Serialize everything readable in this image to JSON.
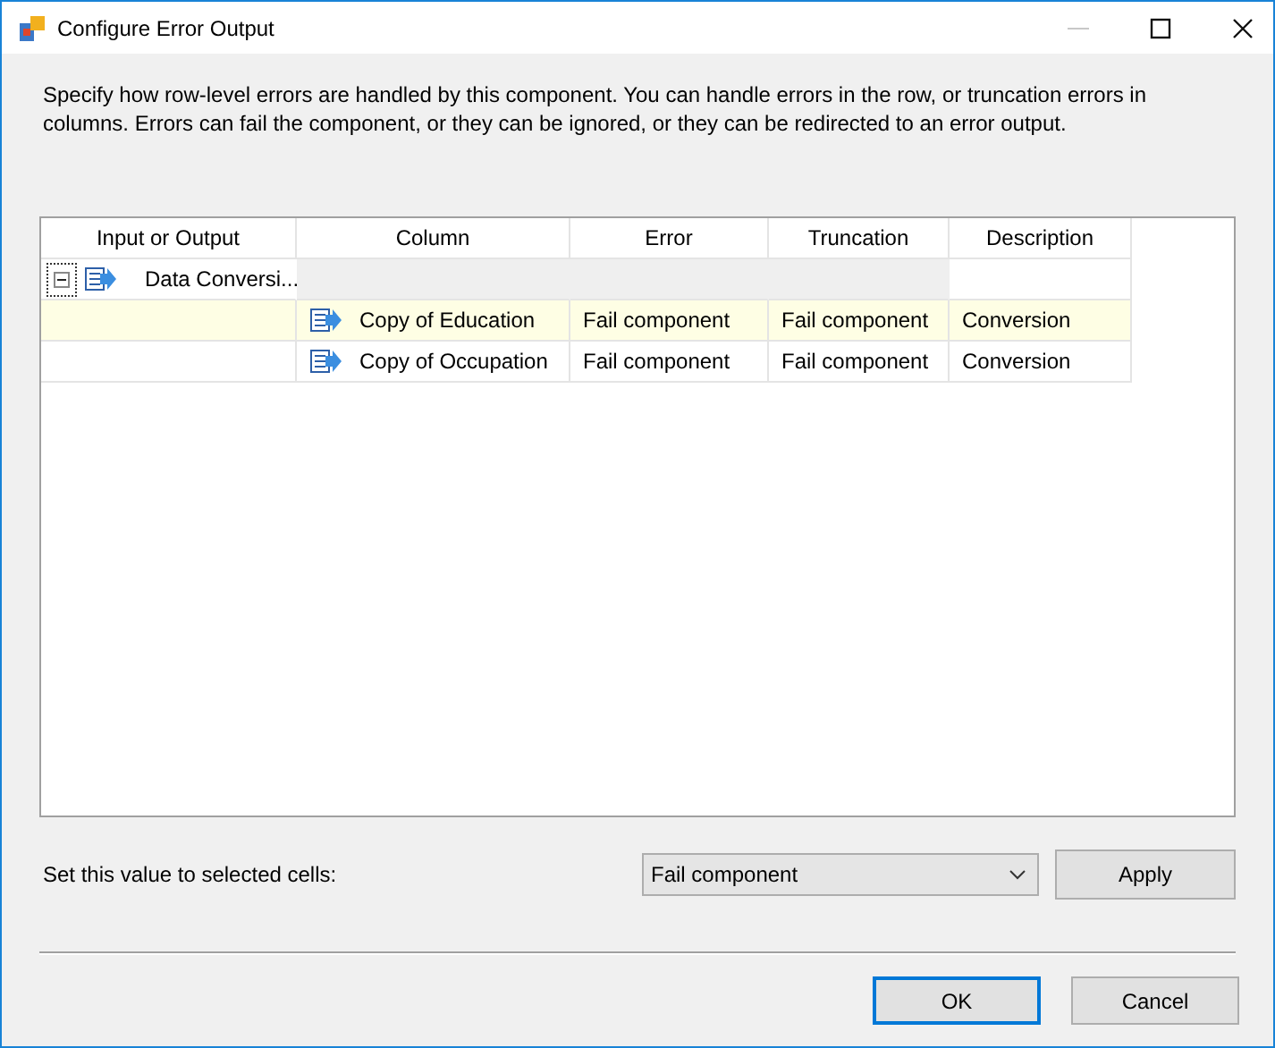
{
  "window": {
    "title": "Configure Error Output"
  },
  "instructions": "Specify how row-level errors are handled by this component. You can handle errors in the row, or truncation errors in columns. Errors can fail the component, or they can be ignored, or they can be redirected to an error output.",
  "grid": {
    "columns": [
      "Input or Output",
      "Column",
      "Error",
      "Truncation",
      "Description"
    ],
    "groups": [
      {
        "name": "Data Conversi...",
        "expanded": true,
        "children": [
          {
            "column": "Copy of Education",
            "error": "Fail component",
            "truncation": "Fail component",
            "description": "Conversion",
            "selected": true
          },
          {
            "column": "Copy of Occupation",
            "error": "Fail component",
            "truncation": "Fail component",
            "description": "Conversion",
            "selected": false
          }
        ]
      }
    ]
  },
  "set_value": {
    "label": "Set this value to selected cells:",
    "value": "Fail component",
    "button": "Apply"
  },
  "buttons": [
    {
      "label": "OK",
      "default": true
    },
    {
      "label": "Cancel",
      "default": false
    }
  ]
}
